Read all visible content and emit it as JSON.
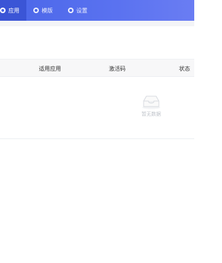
{
  "nav": {
    "items": [
      {
        "label": "应用",
        "icon": "circle-icon",
        "active": true
      },
      {
        "label": "模版",
        "icon": "circle-icon",
        "active": false
      },
      {
        "label": "设置",
        "icon": "circle-icon",
        "active": false
      }
    ]
  },
  "table": {
    "columns": [
      "适用应用",
      "激活码",
      "状态"
    ],
    "rows": [],
    "empty_text": "暂无数据"
  },
  "colors": {
    "accent": "#4a66e8",
    "active_nav": "#3b55d6",
    "header_bg": "#f7f7f8"
  }
}
